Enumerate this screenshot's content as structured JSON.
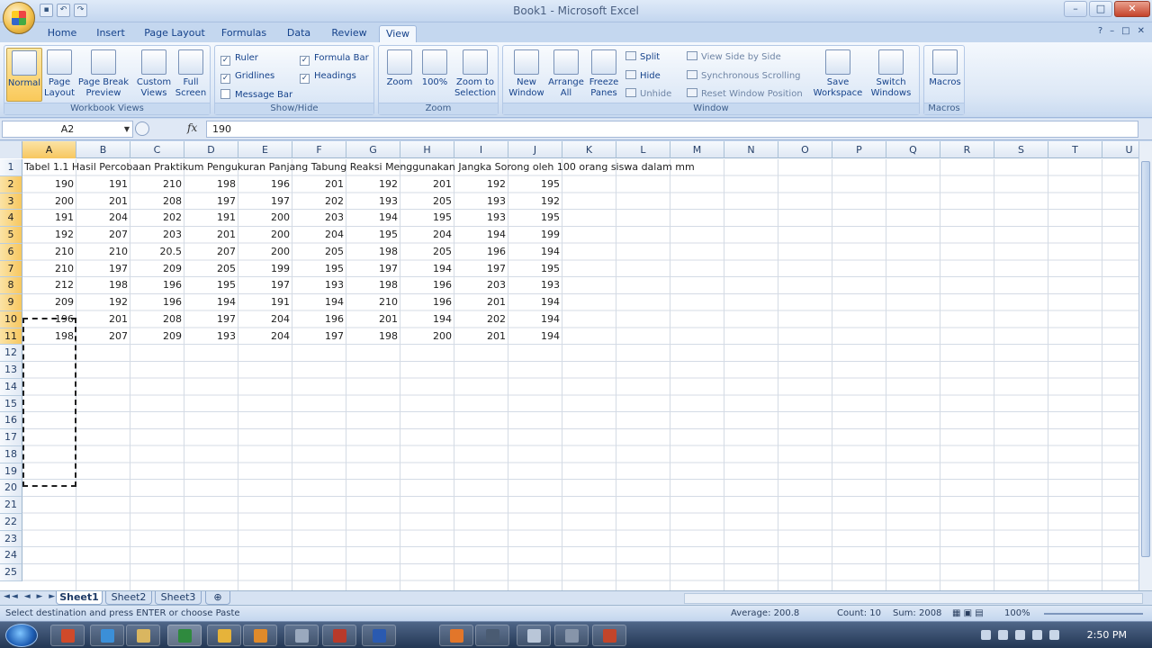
{
  "window": {
    "title": "Book1 - Microsoft Excel"
  },
  "tabs": [
    "Home",
    "Insert",
    "Page Layout",
    "Formulas",
    "Data",
    "Review",
    "View"
  ],
  "active_tab": "View",
  "ribbon": {
    "workbook_views": {
      "label": "Workbook Views",
      "normal": "Normal",
      "page_layout": [
        "Page",
        "Layout"
      ],
      "page_break": [
        "Page Break",
        "Preview"
      ],
      "custom_views": [
        "Custom",
        "Views"
      ],
      "full_screen": [
        "Full",
        "Screen"
      ]
    },
    "show_hide": {
      "label": "Show/Hide",
      "ruler": "Ruler",
      "gridlines": "Gridlines",
      "message_bar": "Message Bar",
      "formula_bar": "Formula Bar",
      "headings": "Headings",
      "checked": [
        "Ruler",
        "Gridlines",
        "Formula Bar",
        "Headings"
      ]
    },
    "zoom": {
      "label": "Zoom",
      "zoom": "Zoom",
      "hundred": "100%",
      "zoom_selection": [
        "Zoom to",
        "Selection"
      ]
    },
    "window_group": {
      "label": "Window",
      "new_window": [
        "New",
        "Window"
      ],
      "arrange_all": [
        "Arrange",
        "All"
      ],
      "freeze_panes": [
        "Freeze",
        "Panes"
      ],
      "split": "Split",
      "hide": "Hide",
      "unhide": "Unhide",
      "side_by_side": "View Side by Side",
      "sync_scroll": "Synchronous Scrolling",
      "reset_position": "Reset Window Position",
      "save_workspace": [
        "Save",
        "Workspace"
      ],
      "switch_windows": [
        "Switch",
        "Windows"
      ]
    },
    "macros": {
      "label": "Macros",
      "button": "Macros"
    }
  },
  "formula_bar": {
    "name_box": "A2",
    "fx": "fx",
    "content": "190"
  },
  "columns": [
    "A",
    "B",
    "C",
    "D",
    "E",
    "F",
    "G",
    "H",
    "I",
    "J",
    "K",
    "L",
    "M",
    "N",
    "O",
    "P",
    "Q",
    "R",
    "S",
    "T",
    "U"
  ],
  "selected_column": "A",
  "rows": [
    "1",
    "2",
    "3",
    "4",
    "5",
    "6",
    "7",
    "8",
    "9",
    "10",
    "11",
    "12",
    "13",
    "14",
    "15",
    "16",
    "17",
    "18",
    "19",
    "20",
    "21",
    "22",
    "23",
    "24",
    "25"
  ],
  "selected_rows": [
    "2",
    "3",
    "4",
    "5",
    "6",
    "7",
    "8",
    "9",
    "10",
    "11"
  ],
  "sheet_title": "Tabel 1.1 Hasil Percobaan Praktikum Pengukuran Panjang Tabung Reaksi Menggunakan Jangka Sorong oleh 100 orang siswa dalam mm",
  "table": [
    [
      "190",
      "191",
      "210",
      "198",
      "196",
      "201",
      "192",
      "201",
      "192",
      "195"
    ],
    [
      "200",
      "201",
      "208",
      "197",
      "197",
      "202",
      "193",
      "205",
      "193",
      "192"
    ],
    [
      "191",
      "204",
      "202",
      "191",
      "200",
      "203",
      "194",
      "195",
      "193",
      "195"
    ],
    [
      "192",
      "207",
      "203",
      "201",
      "200",
      "204",
      "195",
      "204",
      "194",
      "199"
    ],
    [
      "210",
      "210",
      "20.5",
      "207",
      "200",
      "205",
      "198",
      "205",
      "196",
      "194"
    ],
    [
      "210",
      "197",
      "209",
      "205",
      "199",
      "195",
      "197",
      "194",
      "197",
      "195"
    ],
    [
      "212",
      "198",
      "196",
      "195",
      "197",
      "193",
      "198",
      "196",
      "203",
      "193"
    ],
    [
      "209",
      "192",
      "196",
      "194",
      "191",
      "194",
      "210",
      "196",
      "201",
      "194"
    ],
    [
      "196",
      "201",
      "208",
      "197",
      "204",
      "196",
      "201",
      "194",
      "202",
      "194"
    ],
    [
      "198",
      "207",
      "209",
      "193",
      "204",
      "197",
      "198",
      "200",
      "201",
      "194"
    ]
  ],
  "sheets": [
    "Sheet1",
    "Sheet2",
    "Sheet3"
  ],
  "active_sheet": "Sheet1",
  "status": {
    "message": "Select destination and press ENTER or choose Paste",
    "average": "Average: 200.8",
    "count": "Count: 10",
    "sum": "Sum: 2008",
    "zoom": "100%"
  },
  "taskbar": {
    "clock": "2:50 PM"
  },
  "colors": {
    "accent": "#15428b",
    "selection": "#f7c75f",
    "ribbon": "#dde8f6"
  }
}
